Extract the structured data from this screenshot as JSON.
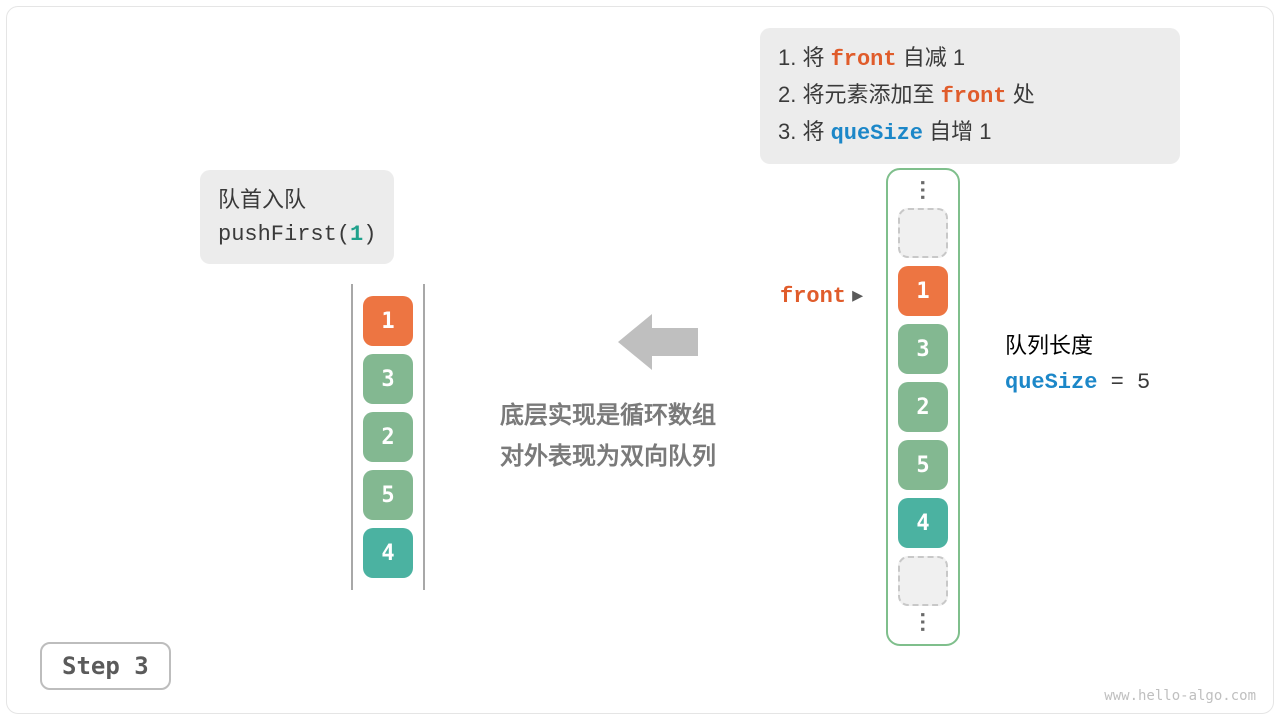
{
  "steps_box": {
    "line1_prefix": "1. 将 ",
    "line1_kw": "front",
    "line1_suffix": " 自减 1",
    "line2_prefix": "2. 将元素添加至 ",
    "line2_kw": "front",
    "line2_suffix": " 处",
    "line3_prefix": "3. 将 ",
    "line3_kw": "queSize",
    "line3_suffix": " 自增 1"
  },
  "push_box": {
    "title": "队首入队",
    "fn": "pushFirst(",
    "arg": "1",
    "close": ")"
  },
  "center_text": {
    "line1": "底层实现是循环数组",
    "line2": "对外表现为双向队列"
  },
  "front_label": "front",
  "front_pointer": " ▸",
  "queue_len_label": "队列长度",
  "que_size_name": "queSize",
  "que_size_eq": " = ",
  "que_size_val": "5",
  "deque_cells": [
    "1",
    "3",
    "2",
    "5",
    "4"
  ],
  "circ_cells": [
    {
      "t": "dots"
    },
    {
      "t": "empty"
    },
    {
      "t": "orange",
      "v": "1"
    },
    {
      "t": "green",
      "v": "3"
    },
    {
      "t": "green",
      "v": "2"
    },
    {
      "t": "green",
      "v": "5"
    },
    {
      "t": "teal",
      "v": "4"
    },
    {
      "t": "empty"
    },
    {
      "t": "dots"
    }
  ],
  "step_label": "Step 3",
  "watermark": "www.hello-algo.com"
}
